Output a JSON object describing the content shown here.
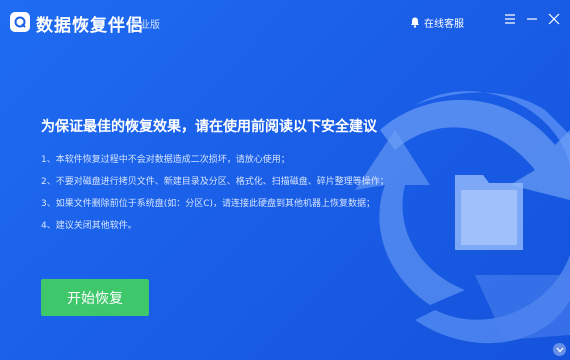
{
  "app": {
    "title": "数据恢复伴侣",
    "edition": "专业版",
    "service_label": "在线客服"
  },
  "main": {
    "headline": "为保证最佳的恢复效果，请在使用前阅读以下安全建议",
    "tips": [
      "1、本软件恢复过程中不会对数据造成二次损坏，请放心使用；",
      "2、不要对磁盘进行拷贝文件、新建目录及分区、格式化、扫描磁盘、碎片整理等操作；",
      "3、如果文件删除前位于系统盘(如：分区C)，请连接此硬盘到其他机器上恢复数据；",
      "4、建议关闭其他软件。"
    ],
    "start_button": "开始恢复"
  },
  "colors": {
    "background": "#1a5fe8",
    "start_button": "#3ec86b",
    "graphic": "#5d93f5"
  },
  "icons": [
    "app-logo-icon",
    "bell-icon",
    "menu-icon",
    "minimize-icon",
    "close-icon",
    "recycle-arrows-icon",
    "folder-icon",
    "chevron-down-icon"
  ]
}
